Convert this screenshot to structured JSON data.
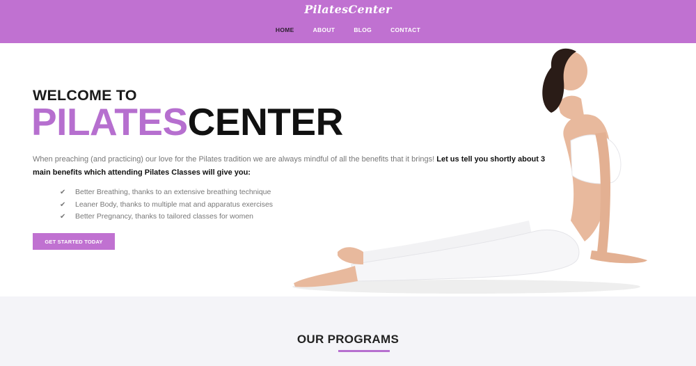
{
  "header": {
    "logo": "PilatesCenter",
    "nav": [
      "HOME",
      "ABOUT",
      "BLOG",
      "CONTACT"
    ],
    "active_nav": "HOME"
  },
  "hero": {
    "welcome": "WELCOME TO",
    "brand_part1": "PILATES",
    "brand_part2": "CENTER",
    "intro_plain": "When preaching (and practicing) our love for the Pilates tradition we are always mindful of all the benefits that it brings! ",
    "intro_bold": "Let us tell you shortly about 3 main benefits which attending Pilates Classes will give you:",
    "benefits": [
      "Better Breathing, thanks to an extensive breathing technique",
      "Leaner Body, thanks to multiple mat and apparatus exercises",
      "Better Pregnancy, thanks to tailored classes for women"
    ],
    "cta": "GET STARTED TODAY"
  },
  "programs": {
    "title": "OUR PROGRAMS"
  },
  "colors": {
    "accent": "#c071d1",
    "brand_purple": "#b66fcf",
    "dark": "#111111"
  },
  "icons": {
    "benefit_icon": "checkmark-icon"
  }
}
